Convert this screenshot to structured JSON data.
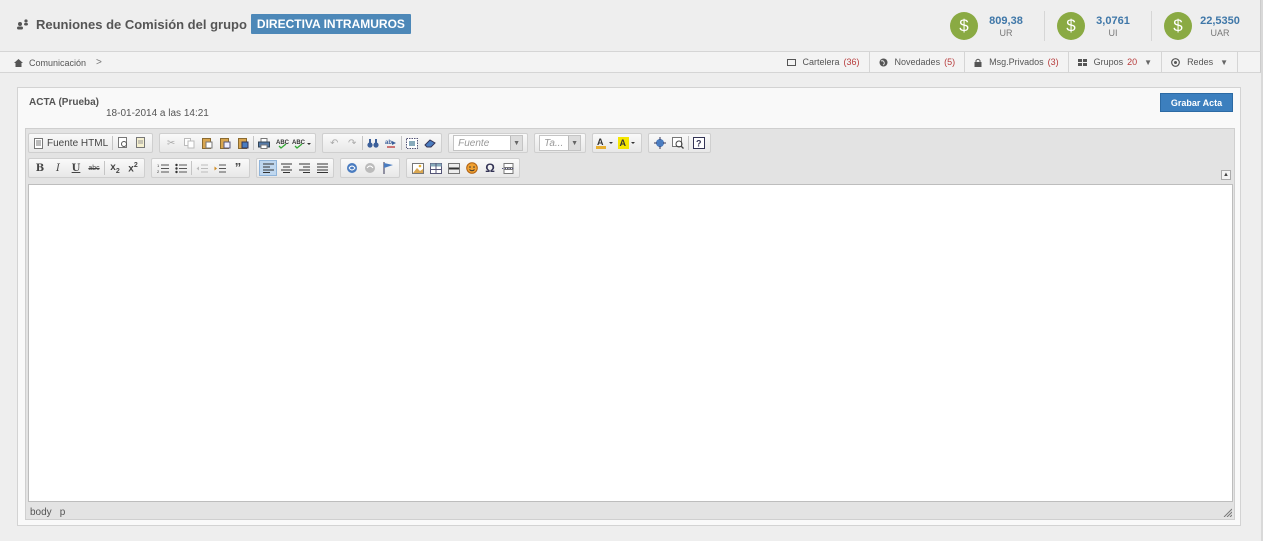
{
  "header": {
    "title": "Reuniones de Comisión del grupo",
    "group": "DIRECTIVA INTRAMUROS",
    "rates": [
      {
        "value": "809,38",
        "unit": "UR",
        "symbol": "$"
      },
      {
        "value": "3,0761",
        "unit": "UI",
        "symbol": "$"
      },
      {
        "value": "22,5350",
        "unit": "UAR",
        "symbol": "$"
      }
    ]
  },
  "nav": {
    "breadcrumb": "Comunicación",
    "chevron": ">",
    "links": {
      "cartelera": {
        "label": "Cartelera",
        "count": "(36)"
      },
      "novedades": {
        "label": "Novedades",
        "count": "(5)"
      },
      "mensajes": {
        "label": "Msg.Privados",
        "count": "(3)"
      },
      "grupos": {
        "label": "Grupos",
        "count": "20"
      },
      "redes": {
        "label": "Redes"
      }
    }
  },
  "panel": {
    "title": "ACTA (Prueba)",
    "date": "18-01-2014 a las 14:21",
    "save_label": "Grabar Acta"
  },
  "editor": {
    "source_label": "Fuente HTML",
    "font_placeholder": "Fuente",
    "size_placeholder": "Ta...",
    "status_path": [
      "body",
      "p"
    ]
  }
}
